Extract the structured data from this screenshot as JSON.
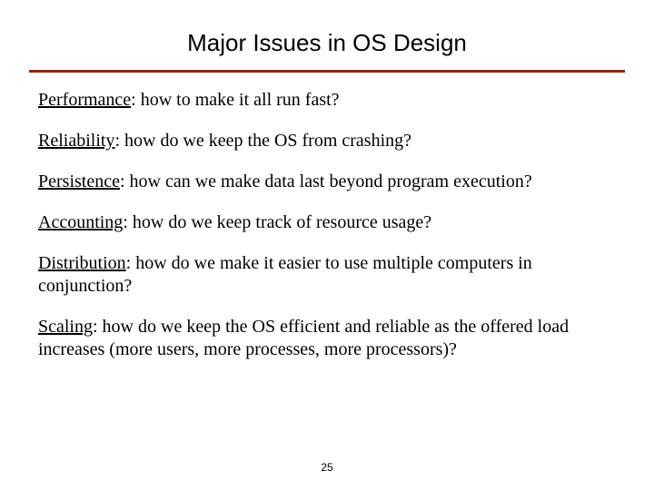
{
  "title": "Major Issues in OS Design",
  "points": [
    {
      "term": "Performance",
      "rest": ": how to make it all run fast?"
    },
    {
      "term": "Reliability",
      "rest": ": how do we keep the OS from crashing?"
    },
    {
      "term": "Persistence",
      "rest": ": how can we make data last beyond program execution?"
    },
    {
      "term": "Accounting",
      "rest": ": how do we keep track of resource usage?"
    },
    {
      "term": "Distribution",
      "rest": ": how do we make it easier to use multiple computers in conjunction?"
    },
    {
      "term": "Scaling",
      "rest": ": how do we keep the OS efficient and reliable as the offered load increases (more users, more processes, more processors)?"
    }
  ],
  "page_number": "25"
}
